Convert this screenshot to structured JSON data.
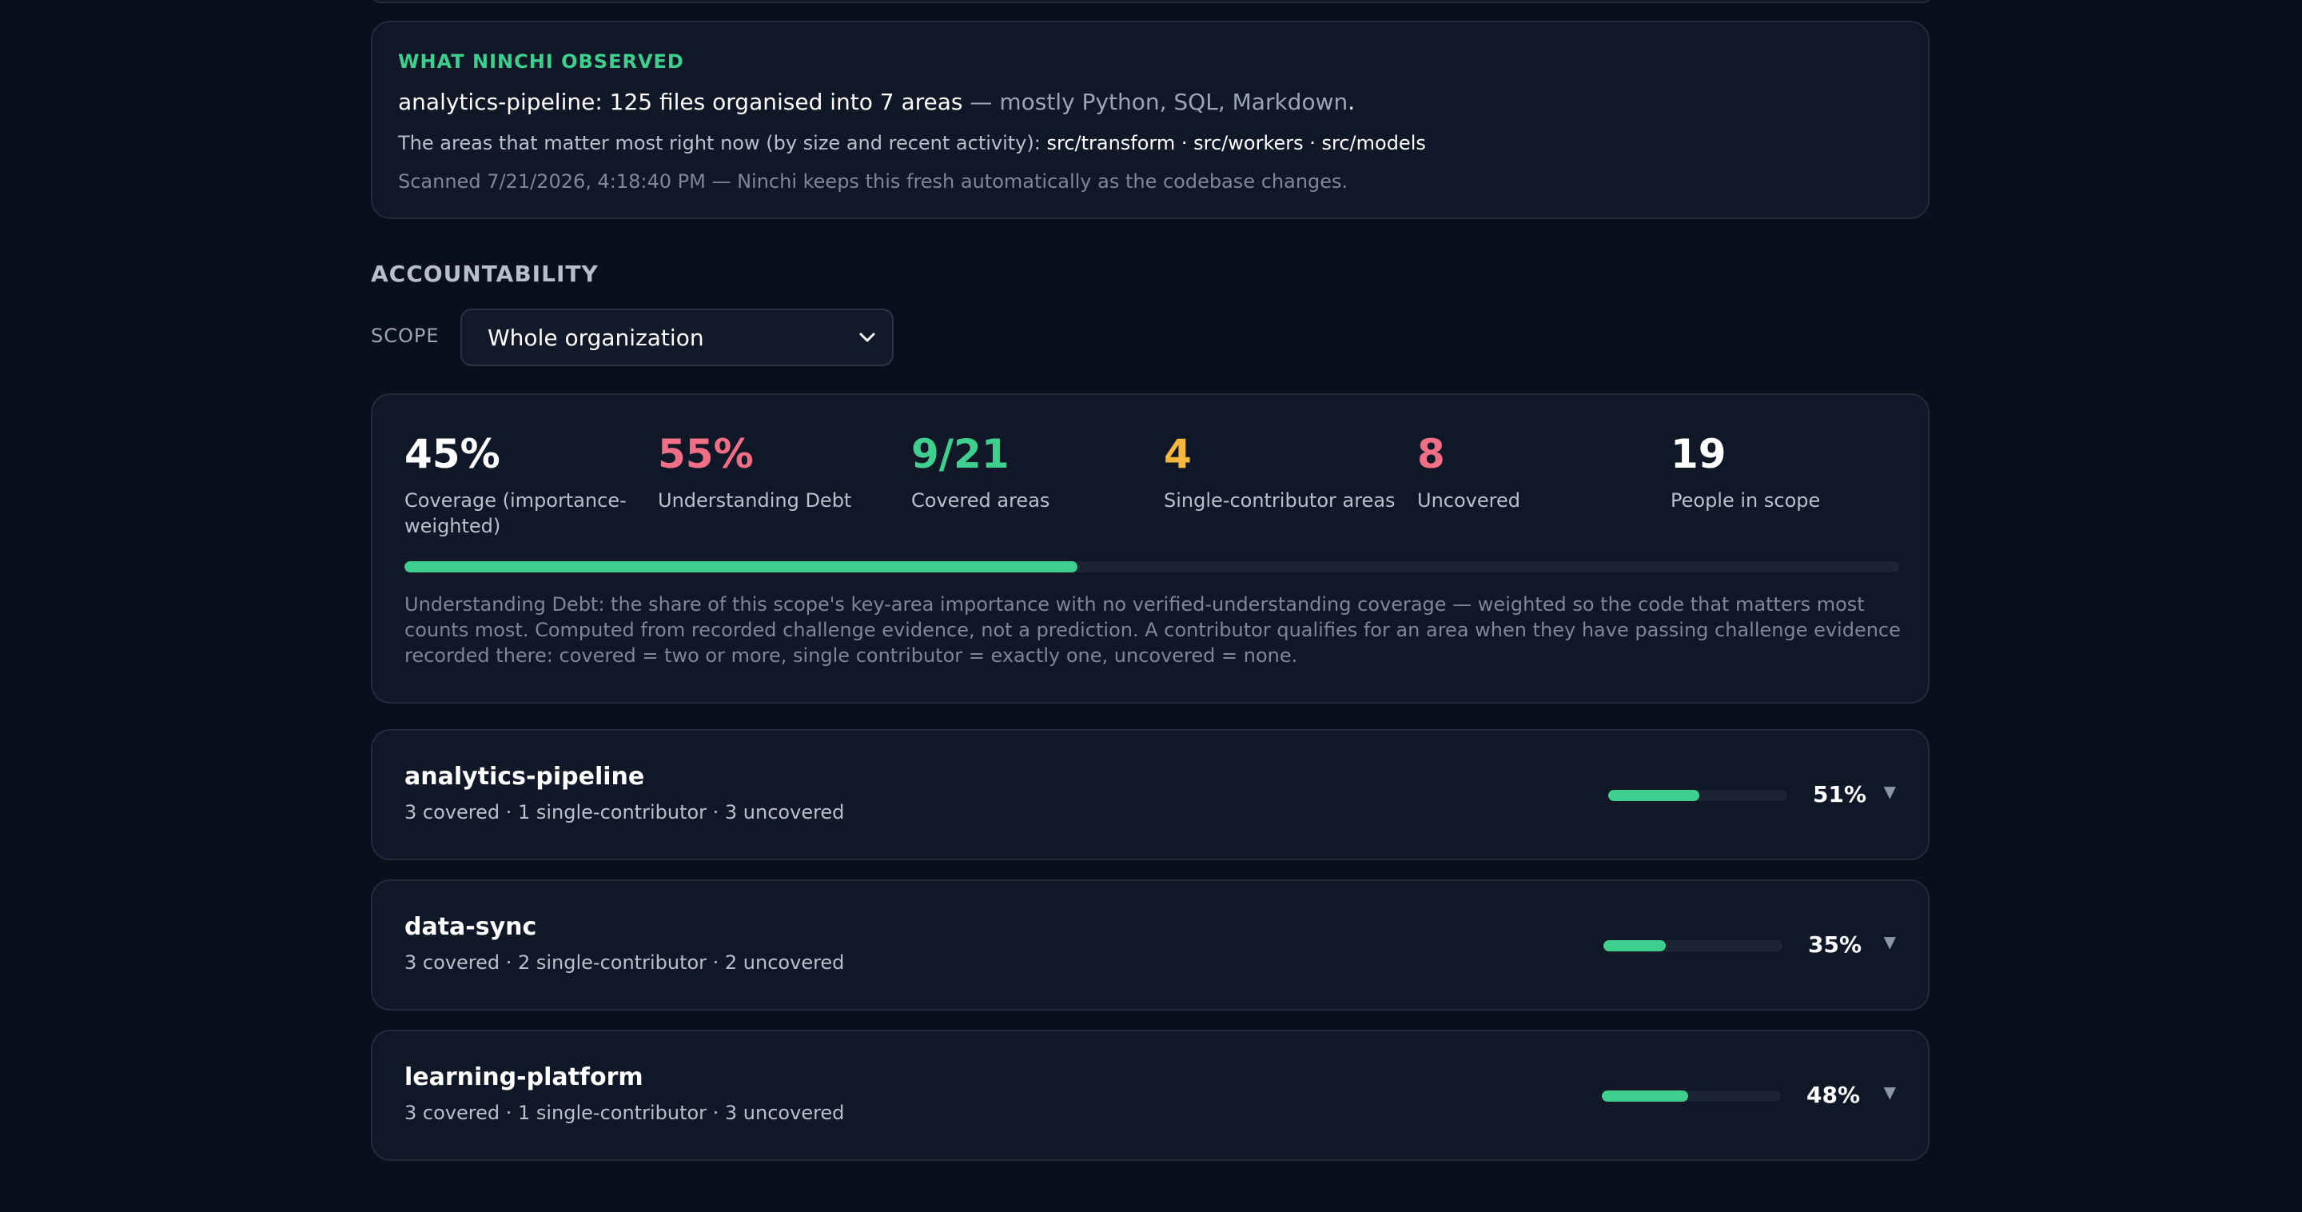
{
  "observed": {
    "eyebrow": "WHAT NINCHI OBSERVED",
    "headline_main": "analytics-pipeline: 125 files organised into 7 areas",
    "headline_muted": " — mostly Python, SQL, Markdown",
    "headline_end": ".",
    "areas_prefix": "The areas that matter most right now (by size and recent activity): ",
    "areas_list": "src/transform · src/workers · src/models",
    "scan_text": "Scanned 7/21/2026, 4:18:40 PM — Ninchi keeps this fresh automatically as the codebase changes."
  },
  "accountability": {
    "title": "ACCOUNTABILITY",
    "scope_label": "SCOPE",
    "scope_value": "Whole organization"
  },
  "stats": [
    {
      "value": "45%",
      "label": "Coverage (importance-weighted)",
      "color": "#ffffff"
    },
    {
      "value": "55%",
      "label": "Understanding Debt",
      "color": "#f06e86"
    },
    {
      "value": "9/21",
      "label": "Covered areas",
      "color": "#3ecf8e"
    },
    {
      "value": "4",
      "label": "Single-contributor areas",
      "color": "#f5b83d"
    },
    {
      "value": "8",
      "label": "Uncovered",
      "color": "#f06e86"
    },
    {
      "value": "19",
      "label": "People in scope",
      "color": "#ffffff"
    }
  ],
  "coverage_fraction": 0.45,
  "explanation": "Understanding Debt: the share of this scope's key-area importance with no verified-understanding coverage — weighted so the code that matters most counts most. Computed from recorded challenge evidence, not a prediction. A contributor qualifies for an area when they have passing challenge evidence recorded there: covered = two or more, single contributor = exactly one, uncovered = none.",
  "repos": [
    {
      "name": "analytics-pipeline",
      "summary": "3 covered · 1 single-contributor · 3 uncovered",
      "coverage": 0.51,
      "pct_label": "51%"
    },
    {
      "name": "data-sync",
      "summary": "3 covered · 2 single-contributor · 2 uncovered",
      "coverage": 0.35,
      "pct_label": "35%"
    },
    {
      "name": "learning-platform",
      "summary": "3 covered · 1 single-contributor · 3 uncovered",
      "coverage": 0.48,
      "pct_label": "48%"
    }
  ]
}
